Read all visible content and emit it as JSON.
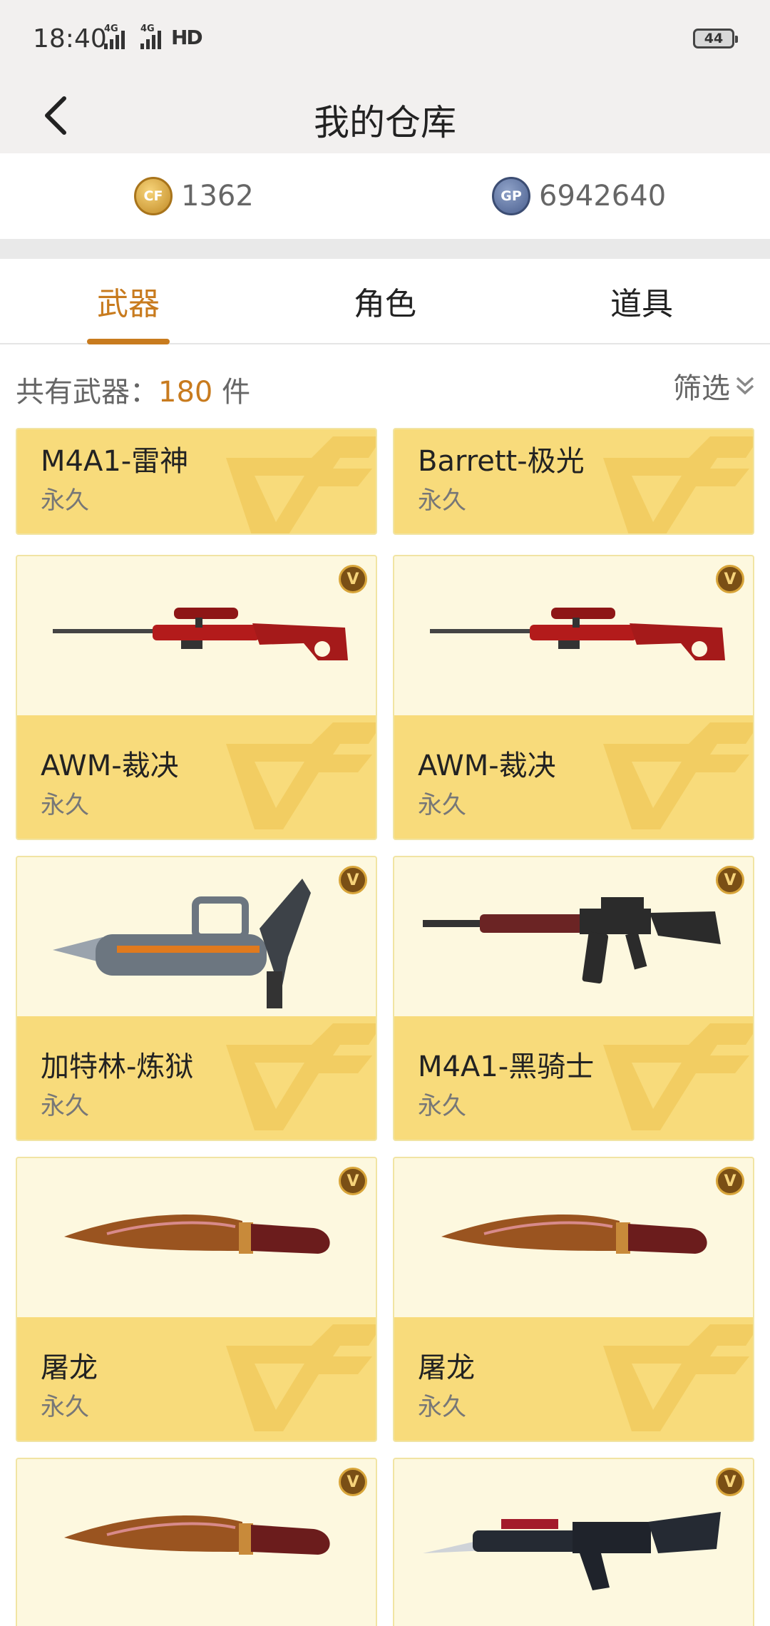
{
  "status_bar": {
    "time": "18:40",
    "network_1": "4G",
    "network_2": "4G",
    "hd": "HD",
    "battery": "44"
  },
  "header": {
    "title": "我的仓库"
  },
  "currency": {
    "cf_icon_text": "CF",
    "cf_points": "1362",
    "gp_icon_text": "GP",
    "gp_points": "6942640"
  },
  "tabs": [
    {
      "label": "武器"
    },
    {
      "label": "角色"
    },
    {
      "label": "道具"
    }
  ],
  "inventory": {
    "count_label": "共有武器：",
    "count": "180",
    "count_unit": " 件",
    "filter_label": "筛选"
  },
  "cards": [
    {
      "name": "M4A1-雷神",
      "duration": "永久"
    },
    {
      "name": "Barrett-极光",
      "duration": "永久"
    },
    {
      "name": "AWM-裁决",
      "duration": "永久",
      "vip": "V",
      "icon": "sniper-rifle"
    },
    {
      "name": "AWM-裁决",
      "duration": "永久",
      "vip": "V",
      "icon": "sniper-rifle"
    },
    {
      "name": "加特林-炼狱",
      "duration": "永久",
      "vip": "V",
      "icon": "gatling-gun"
    },
    {
      "name": "M4A1-黑骑士",
      "duration": "永久",
      "vip": "V",
      "icon": "assault-rifle"
    },
    {
      "name": "屠龙",
      "duration": "永久",
      "vip": "V",
      "icon": "kukri-knife"
    },
    {
      "name": "屠龙",
      "duration": "永久",
      "vip": "V",
      "icon": "kukri-knife"
    },
    {
      "vip": "V",
      "icon": "kukri-knife"
    },
    {
      "vip": "V",
      "icon": "ak-rifle"
    }
  ],
  "colors": {
    "accent": "#c87b1e",
    "card_footer": "#f8db7b",
    "card_bg": "#fdf8df"
  }
}
